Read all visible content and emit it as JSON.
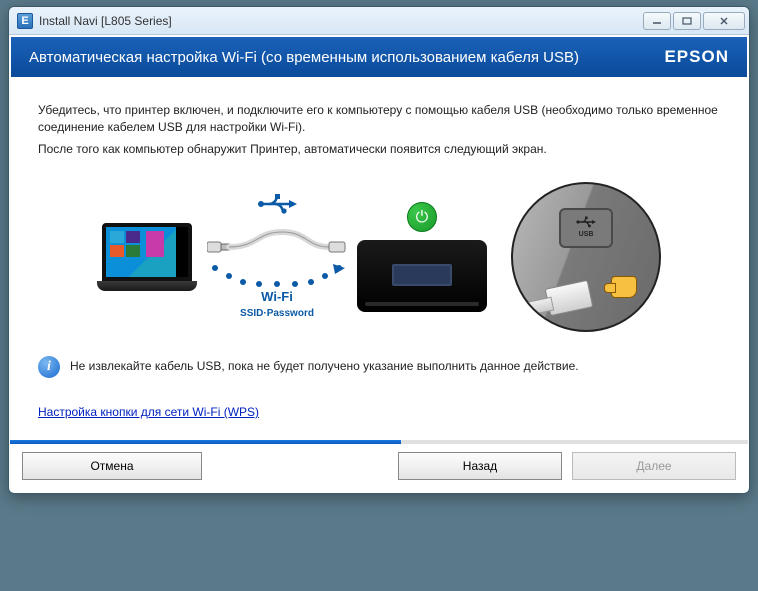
{
  "window": {
    "title": "Install Navi [L805 Series]"
  },
  "header": {
    "title": "Автоматическая настройка Wi-Fi (со временным использованием кабеля USB)",
    "brand": "EPSON"
  },
  "instructions": {
    "line1": "Убедитесь, что принтер включен, и подключите его к компьютеру с помощью кабеля USB (необходимо только временное соединение кабелем USB для настройки Wi-Fi).",
    "line2": "После того как компьютер обнаружит Принтер, автоматически появится следующий экран."
  },
  "illustration": {
    "wifi_label": "Wi-Fi",
    "wifi_sub": "SSID·Password",
    "usb_port_label": "USB"
  },
  "info": {
    "text": "Не извлекайте кабель USB, пока не будет получено указание выполнить данное действие."
  },
  "link": {
    "wps": "Настройка кнопки для сети Wi-Fi (WPS)"
  },
  "buttons": {
    "cancel": "Отмена",
    "back": "Назад",
    "next": "Далее"
  },
  "progress_percent": 53
}
